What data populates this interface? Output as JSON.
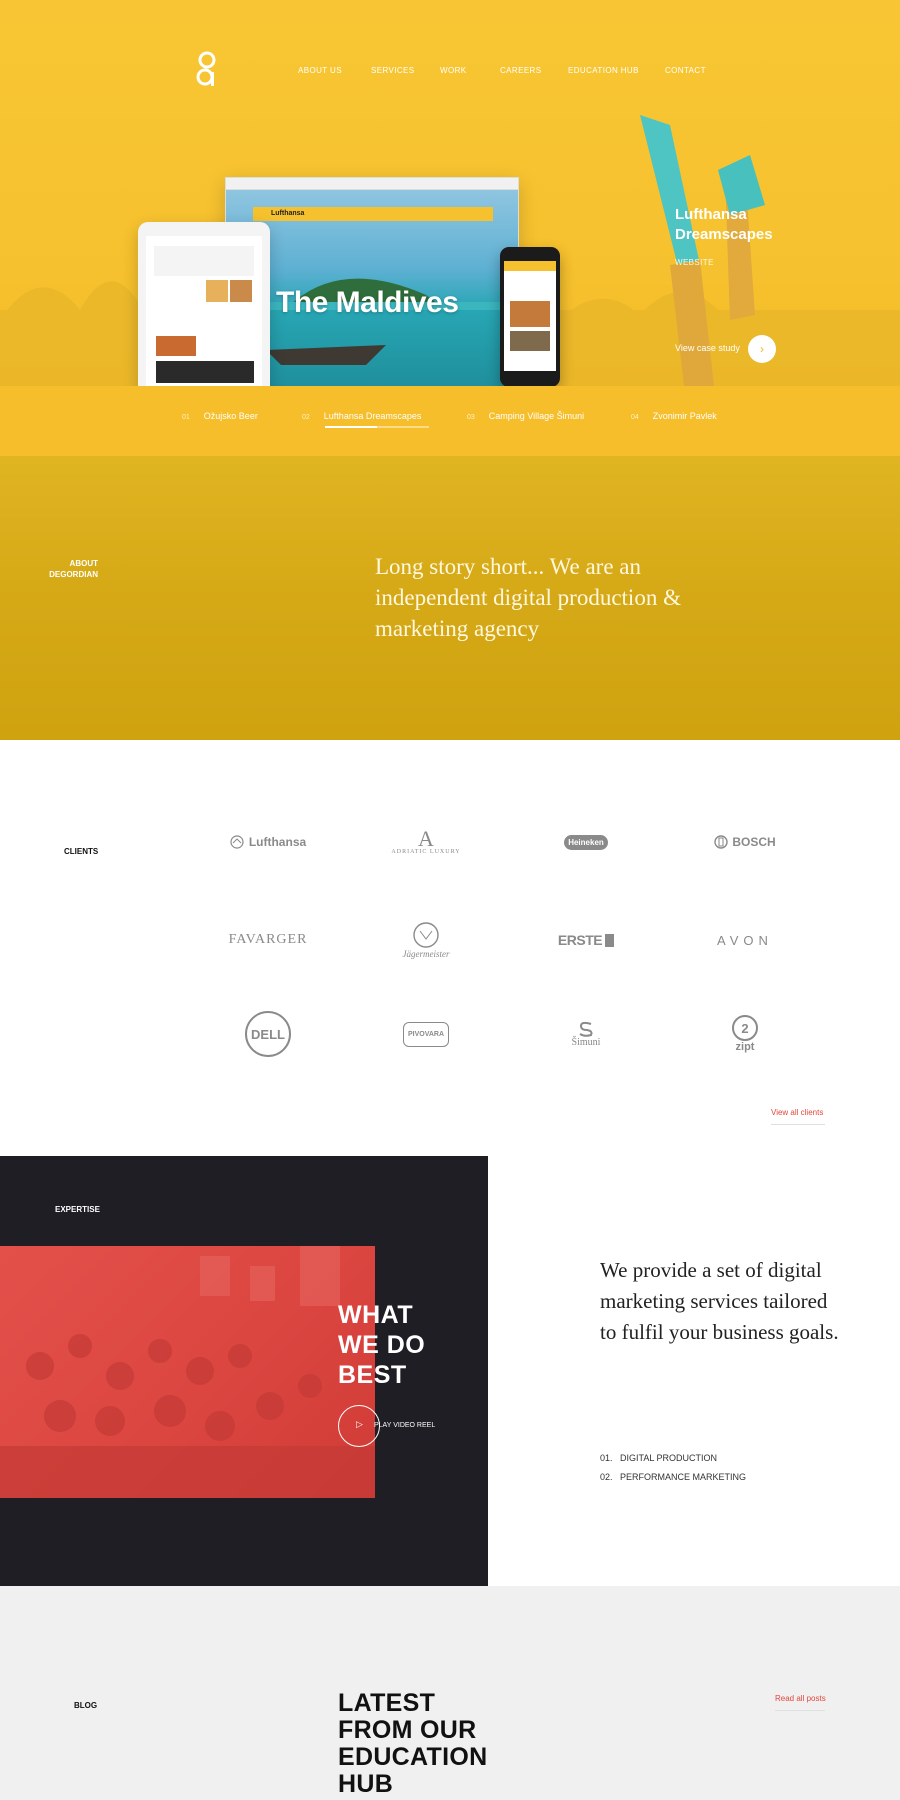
{
  "nav": {
    "items": [
      "ABOUT US",
      "SERVICES",
      "WORK",
      "CAREERS",
      "EDUCATION HUB",
      "CONTACT"
    ]
  },
  "hero": {
    "case_title": "Lufthansa Dreamscapes",
    "case_type": "WEBSITE",
    "case_link": "View case study",
    "screen_title": "The Maldives",
    "brand_badge": "Lufthansa"
  },
  "slides": [
    {
      "num": "01",
      "label": "Ožujsko Beer"
    },
    {
      "num": "02",
      "label": "Lufthansa Dreamscapes"
    },
    {
      "num": "03",
      "label": "Camping Village Šimuni"
    },
    {
      "num": "04",
      "label": "Zvonimir Pavlek"
    }
  ],
  "slides_progress": 0.5,
  "about": {
    "label_line1": "ABOUT",
    "label_line2": "DEGORDIAN",
    "text": "Long story short... We are an independent digital production & marketing agency"
  },
  "clients": {
    "label": "CLIENTS",
    "logos": [
      "Lufthansa",
      "ADRIATIC LUXURY",
      "Heineken",
      "BOSCH",
      "FAVARGER",
      "Jägermeister",
      "ERSTE",
      "AVON",
      "DELL",
      "PIVOVARA",
      "Šimuni",
      "zipt"
    ],
    "view_all": "View all clients"
  },
  "expertise": {
    "label": "EXPERTISE",
    "headline_1": "WHAT",
    "headline_2": "WE DO",
    "headline_3": "BEST",
    "play_label": "PLAY VIDEO REEL",
    "text": "We provide a set of digital marketing services tailored to fulfil your business goals.",
    "list": [
      "01.   DIGITAL PRODUCTION",
      "02.   PERFORMANCE MARKETING"
    ]
  },
  "blog": {
    "label": "BLOG",
    "title_1": "LATEST",
    "title_2": "FROM OUR",
    "title_3": "EDUCATION",
    "title_4": "HUB",
    "read_all": "Read all posts"
  },
  "colors": {
    "yellow": "#f6c12e",
    "mustard": "#d6a917",
    "red": "#e2463b",
    "dark": "#1e1e24"
  }
}
